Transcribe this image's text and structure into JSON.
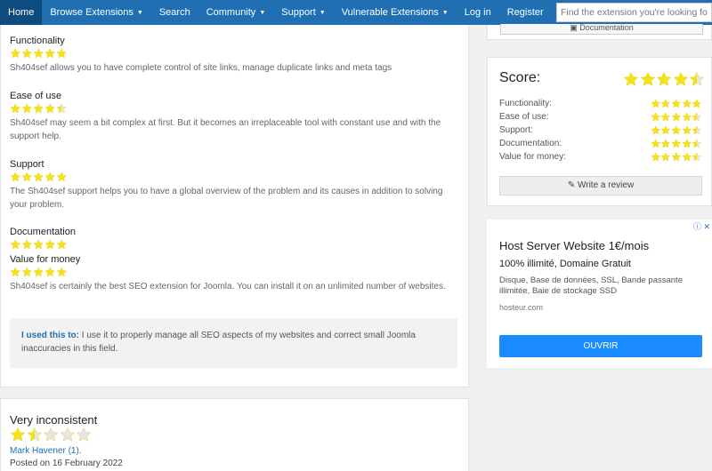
{
  "nav": {
    "items": [
      {
        "label": "Home",
        "active": true,
        "caret": false
      },
      {
        "label": "Browse Extensions",
        "active": false,
        "caret": true
      },
      {
        "label": "Search",
        "active": false,
        "caret": false
      },
      {
        "label": "Community",
        "active": false,
        "caret": true
      },
      {
        "label": "Support",
        "active": false,
        "caret": true
      },
      {
        "label": "Vulnerable Extensions",
        "active": false,
        "caret": true
      },
      {
        "label": "Log in",
        "active": false,
        "caret": false
      },
      {
        "label": "Register",
        "active": false,
        "caret": false
      }
    ],
    "search_placeholder": "Find the extension you're looking for"
  },
  "review": {
    "sections": [
      {
        "title": "Functionality",
        "rating": 5,
        "text": "Sh404sef allows you to have complete control of site links, manage duplicate links and meta tags"
      },
      {
        "title": "Ease of use",
        "rating": 4.5,
        "text": "Sh404sef may seem a bit complex at first. But it becomes an irreplaceable tool with constant use and with the support help."
      },
      {
        "title": "Support",
        "rating": 5,
        "text": "The Sh404sef support helps you to have a global overview of the problem and its causes in addition to solving your problem."
      },
      {
        "title": "Documentation",
        "rating": 5,
        "text": ""
      },
      {
        "title": "Value for money",
        "rating": 5,
        "text": "Sh404sef is certainly the best SEO extension for Joomla. You can install it on an unlimited number of websites."
      }
    ],
    "used_label": "I used this to:",
    "used_text": " I use it to properly manage all SEO aspects of my websites and correct small Joomla inaccuracies in this field."
  },
  "review2": {
    "title": "Very inconsistent",
    "rating": 1.5,
    "author": "Mark Havener (1).",
    "posted": "Posted on 16 February 2022"
  },
  "sidebar": {
    "top_button": "Documentation",
    "score_title": "Score:",
    "score_rating": 4.5,
    "rows": [
      {
        "label": "Functionality:",
        "rating": 5
      },
      {
        "label": "Ease of use:",
        "rating": 4.5
      },
      {
        "label": "Support:",
        "rating": 4.5
      },
      {
        "label": "Documentation:",
        "rating": 4.5
      },
      {
        "label": "Value for money:",
        "rating": 4.5
      }
    ],
    "write_review": "Write a review"
  },
  "ad": {
    "info": "ⓘ ✕",
    "title": "Host Server Website 1€/mois",
    "subtitle": "100% illimité, Domaine Gratuit",
    "description": "Disque, Base de données, SSL, Bande passante illimitée, Baie de stockage SSD",
    "domain": "hosteur.com",
    "button": "OUVRIR"
  },
  "colors": {
    "nav_bg": "#1f6fb2",
    "nav_active": "#0e4c80",
    "star_filled": "#f5e21a",
    "star_empty": "#e6e6e6",
    "link": "#1f6fb2",
    "ad_button": "#1a8cff"
  }
}
